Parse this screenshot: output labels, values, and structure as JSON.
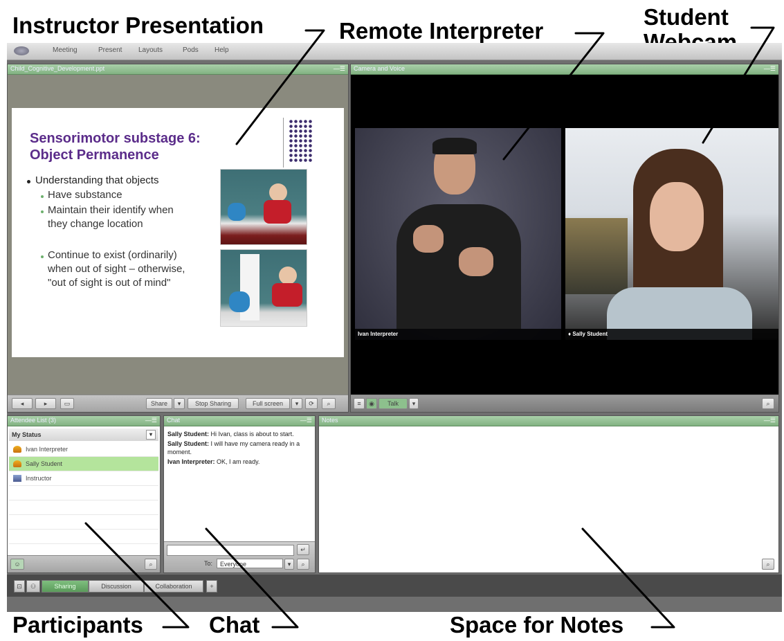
{
  "callouts": {
    "instructor_presentation": "Instructor Presentation",
    "remote_interpreter": "Remote Interpreter",
    "student_webcam_line1": "Student",
    "student_webcam_line2": "Webcam",
    "participants": "Participants",
    "chat": "Chat",
    "space_for_notes": "Space for Notes"
  },
  "menu": [
    "Meeting",
    "Present",
    "Layouts",
    "Pods",
    "Help"
  ],
  "share_pod": {
    "title": "Child_Cognitive_Development.ppt",
    "slide": {
      "title_line1": "Sensorimotor substage 6:",
      "title_line2": "Object Permanence",
      "bullet": "Understanding that objects",
      "subbullets": [
        "Have substance",
        "Maintain their identify when they change location",
        "Continue to exist (ordinarily) when out of sight – otherwise, \"out of sight is out of mind\""
      ]
    },
    "footer": {
      "share_label": "Share",
      "stop_sharing_label": "Stop Sharing",
      "full_screen_label": "Full screen"
    }
  },
  "video_pod": {
    "title": "Camera and Voice",
    "feeds": [
      {
        "label": "Ivan Interpreter"
      },
      {
        "label": "Sally Student"
      }
    ],
    "talk_label": "Talk"
  },
  "attendee_pod": {
    "title": "Attendee List (3)",
    "my_status_label": "My Status",
    "attendees": [
      {
        "name": "Ivan Interpreter",
        "selected": false
      },
      {
        "name": "Sally Student",
        "selected": true
      },
      {
        "name": "Instructor",
        "selected": false
      }
    ]
  },
  "chat_pod": {
    "title": "Chat",
    "messages": [
      {
        "sender": "Sally Student:",
        "text": "Hi Ivan, class is about to start."
      },
      {
        "sender": "Sally Student:",
        "text": "I will have my camera ready in a moment."
      },
      {
        "sender": "Ivan Interpreter:",
        "text": "OK, I am ready."
      }
    ],
    "to_label": "To:",
    "recipient": "Everyone"
  },
  "notes_pod": {
    "title": "Notes"
  },
  "layout_tabs": [
    "Sharing",
    "Discussion",
    "Collaboration"
  ],
  "colors": {
    "slide_title": "#5b2c8a",
    "pod_header": "#94c194",
    "selected_row": "#b4e49c"
  }
}
